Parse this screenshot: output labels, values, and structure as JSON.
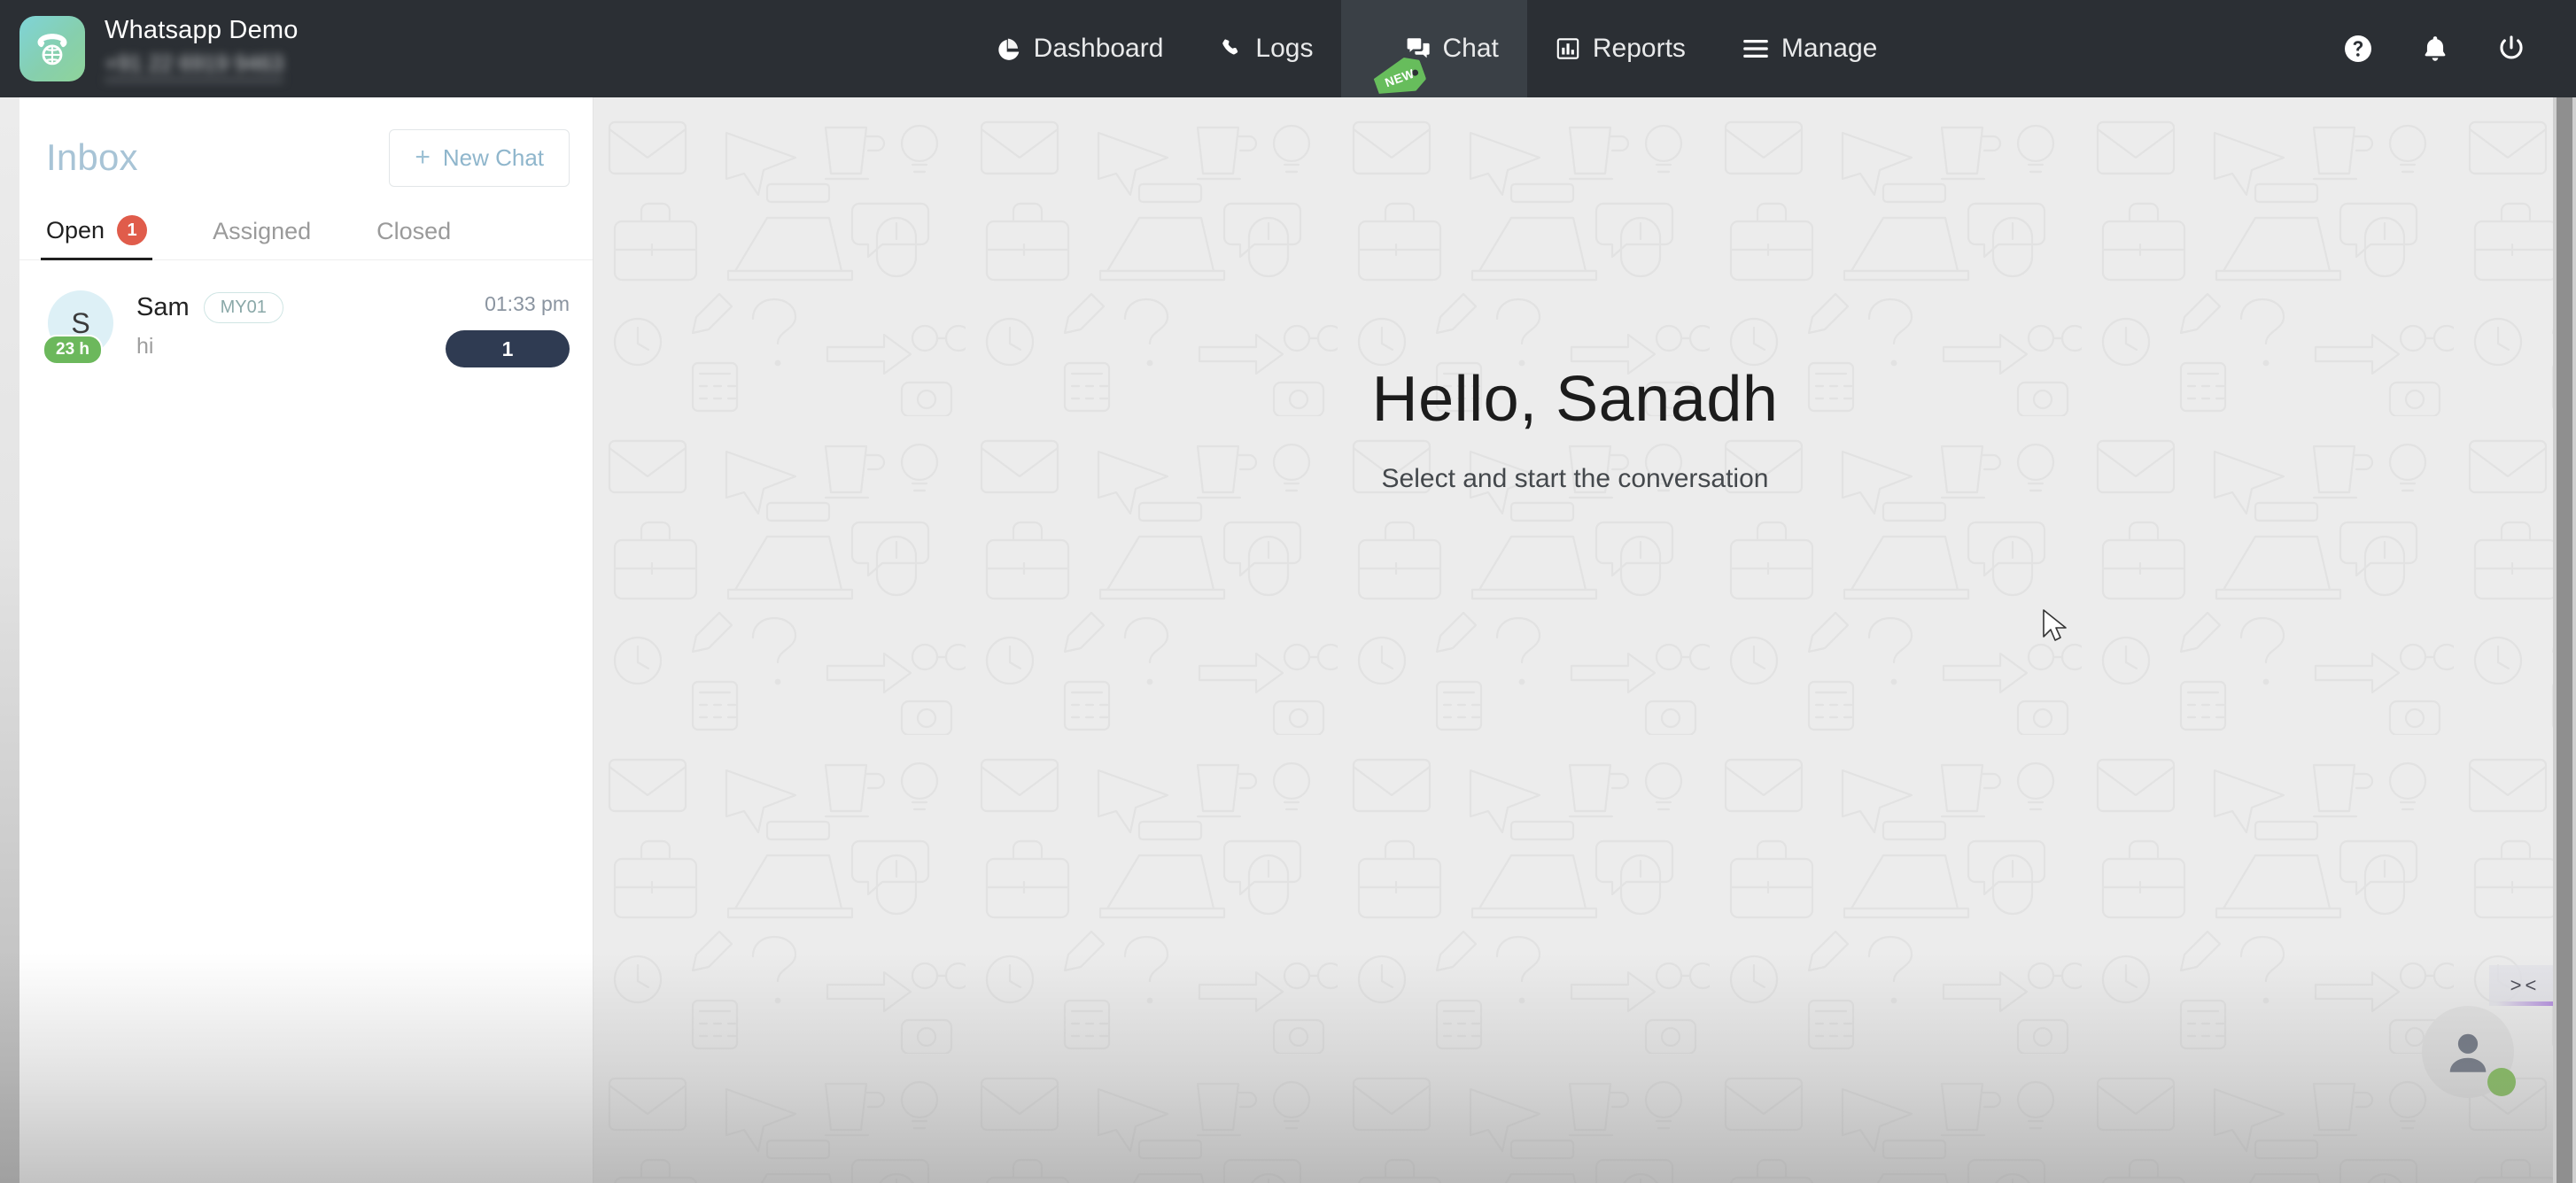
{
  "header": {
    "brand": {
      "title": "Whatsapp Demo",
      "phone": "+91 22 6919 9463",
      "logo_icon": "phone-globe-icon"
    },
    "nav": [
      {
        "label": "Dashboard",
        "icon": "pie-chart-icon",
        "active": false,
        "badge": ""
      },
      {
        "label": "Logs",
        "icon": "phone-icon",
        "active": false,
        "badge": ""
      },
      {
        "label": "Chat",
        "icon": "chat-bubble-icon",
        "active": true,
        "badge": "NEW"
      },
      {
        "label": "Reports",
        "icon": "bar-chart-icon",
        "active": false,
        "badge": ""
      },
      {
        "label": "Manage",
        "icon": "hamburger-icon",
        "active": false,
        "badge": ""
      }
    ],
    "actions": [
      {
        "name": "help-icon",
        "label": "Help"
      },
      {
        "name": "bell-icon",
        "label": "Notifications"
      },
      {
        "name": "power-icon",
        "label": "Logout"
      }
    ]
  },
  "sidebar": {
    "title": "Inbox",
    "new_chat_label": "New Chat",
    "new_chat_plus": "+",
    "tabs": [
      {
        "label": "Open",
        "badge": "1",
        "active": true
      },
      {
        "label": "Assigned",
        "badge": "",
        "active": false
      },
      {
        "label": "Closed",
        "badge": "",
        "active": false
      }
    ],
    "chats": [
      {
        "avatar_initial": "S",
        "timer": "23 h",
        "name": "Sam",
        "tag": "MY01",
        "preview": "hi",
        "time": "01:33 pm",
        "unread": "1"
      }
    ]
  },
  "main": {
    "greeting": "Hello, Sanadh",
    "subtitle": "Select and start the conversation",
    "collapse_handle": "> <",
    "fab": {
      "name": "user-avatar",
      "status": "online"
    }
  },
  "colors": {
    "header_bg": "#2b2f34",
    "header_active_bg": "#3a4046",
    "accent_green": "#6cb85c",
    "badge_red": "#e05c4b",
    "unread_navy": "#2f3b52",
    "inbox_blue": "#a8c4d6",
    "main_bg": "#ececec"
  }
}
